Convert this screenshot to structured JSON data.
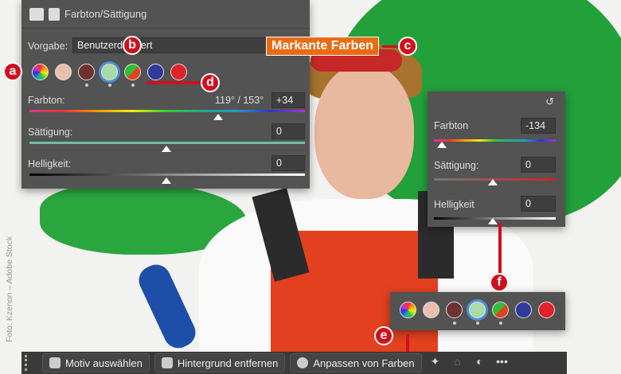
{
  "main_panel": {
    "title": "Farbton/Sättigung",
    "preset_label": "Vorgabe:",
    "preset_value": "Benutzerdefiniert",
    "hue_label": "Farbton:",
    "hue_range": "119° / 153°",
    "hue_value": "+34",
    "saturation_label": "Sättigung:",
    "saturation_value": "0",
    "lightness_label": "Helligkeit:",
    "lightness_value": "0"
  },
  "callout": "Markante Farben",
  "markers": {
    "a": "a",
    "b": "b",
    "c": "c",
    "d": "d",
    "e": "e",
    "f": "f"
  },
  "side_panel": {
    "hue_label": "Farbton",
    "hue_value": "-134",
    "saturation_label": "Sättigung:",
    "saturation_value": "0",
    "lightness_label": "Helligkeit",
    "lightness_value": "0"
  },
  "taskbar": {
    "select_subject": "Motiv auswählen",
    "remove_background": "Hintergrund entfernen",
    "adjust_colors": "Anpassen von Farben",
    "more": "•••"
  },
  "credit": "Foto: Kzenon – Adobe Stock",
  "swatch_colors": [
    "#e9c0ad",
    "#6e3232",
    "#a9dba6",
    "#2f3a9c",
    "#e0222a"
  ]
}
